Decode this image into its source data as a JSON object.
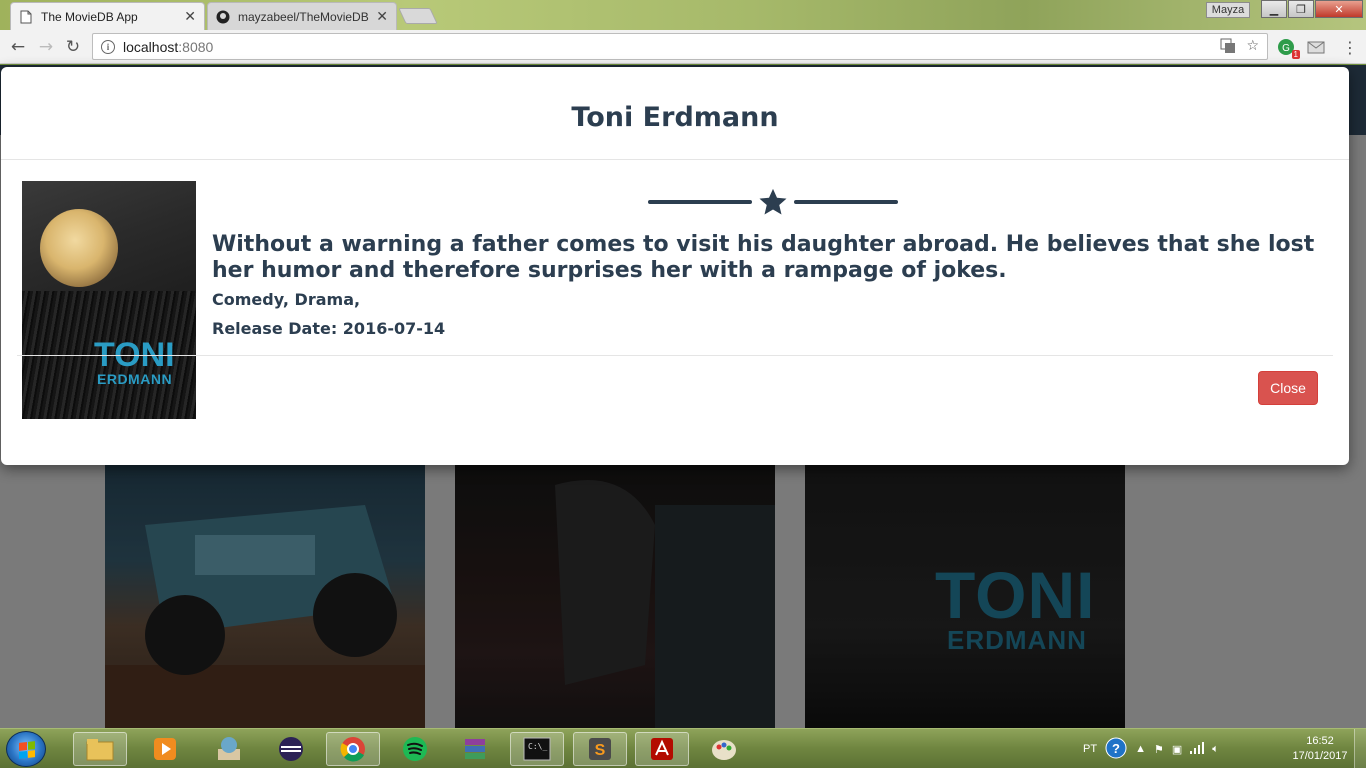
{
  "browser": {
    "tabs": [
      {
        "label": "The MovieDB App",
        "active": true
      },
      {
        "label": "mayzabeel/TheMovieDB",
        "active": false
      }
    ],
    "profile_name": "Mayza",
    "url_host": "localhost",
    "url_port": ":8080",
    "extension_badge": "1"
  },
  "modal": {
    "title": "Toni Erdmann",
    "poster_title": "TONI",
    "poster_subtitle": "ERDMANN",
    "overview": "Without a warning a father comes to visit his daughter abroad. He believes that she lost her humor and therefore surprises her with a rampage of jokes.",
    "genres": "Comedy, Drama,",
    "release_label": "Release Date: 2016-07-14",
    "close_label": "Close",
    "accent_color": "#2c3e50",
    "close_color": "#d9534f"
  },
  "background_grid": {
    "posters": [
      {
        "name": "monster-trucks-poster"
      },
      {
        "name": "dark-thriller-poster"
      },
      {
        "name": "toni-erdmann-poster",
        "title": "TONI",
        "subtitle": "ERDMANN"
      }
    ]
  },
  "taskbar": {
    "apps": [
      "explorer",
      "media-player",
      "control-panel",
      "eclipse",
      "chrome",
      "spotify",
      "winrar",
      "command-prompt",
      "sublime-text",
      "acrobat-reader",
      "paint"
    ],
    "language": "PT",
    "time": "16:52",
    "date": "17/01/2017"
  }
}
